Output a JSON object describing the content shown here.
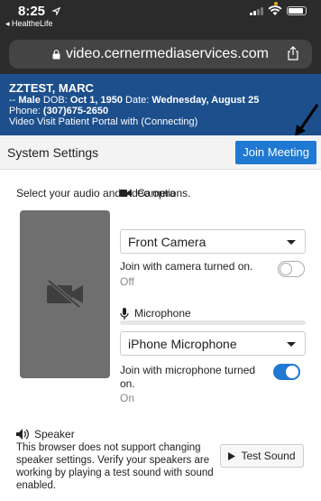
{
  "status_bar": {
    "time": "8:25",
    "back_app": "◂ HealtheLife"
  },
  "browser": {
    "url": "video.cernermediaservices.com"
  },
  "patient": {
    "name": "ZZTEST, MARC",
    "line2_prefix": "-- ",
    "sex": "Male",
    "dob_label": " DOB: ",
    "dob": "Oct 1, 1950",
    "date_label": " Date: ",
    "date": "Wednesday, August 25",
    "phone_label": "Phone: ",
    "phone": "(307)675-2650",
    "portal_status": "Video Visit Patient Portal with (Connecting)"
  },
  "settings": {
    "title": "System Settings",
    "join_label": "Join Meeting",
    "lead": "Select your audio and video options."
  },
  "camera": {
    "label": "Camera",
    "selected": "Front Camera",
    "join_text": "Join with camera turned on.",
    "state": "Off",
    "enabled": false
  },
  "microphone": {
    "label": "Microphone",
    "selected": "iPhone Microphone",
    "join_text": "Join with microphone turned on.",
    "state": "On",
    "enabled": true,
    "level": 0
  },
  "speaker": {
    "label": "Speaker",
    "text": "This browser does not support changing speaker settings. Verify your speakers are working by playing a test sound with sound enabled.",
    "test_label": "Test Sound"
  },
  "colors": {
    "banner": "#1c4f8c",
    "accent": "#1f78d1",
    "chrome": "#2b2b2b"
  }
}
